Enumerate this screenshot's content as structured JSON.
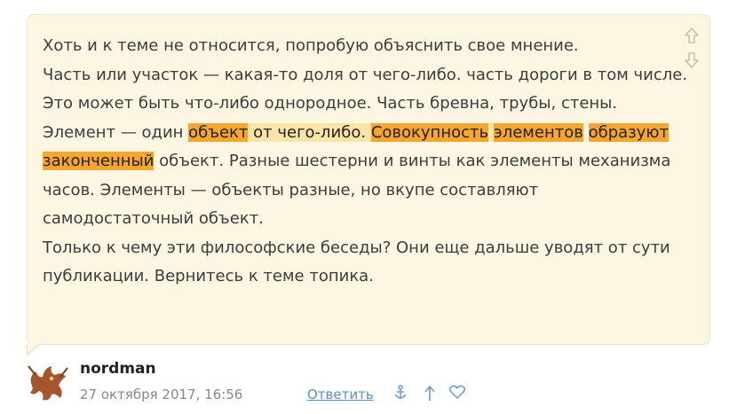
{
  "comment": {
    "lines": [
      [
        "Хоть и к теме не относится, попробую объяснить свое мнение."
      ],
      [
        "Часть или участок — какая-то доля от чего-либо. часть дороги в том числе. Это может быть что-либо однородное. Часть бревна, трубы, стены."
      ],
      [
        "Элемент — один ",
        "объект",
        " ",
        "от чего-либо.",
        " ",
        "Совокупность",
        " ",
        "элементов",
        " ",
        "образуют",
        " ",
        "законченный",
        " объект. Разные шестерни и винты как элементы механизма часов. Элементы — объекты разные, но вкупе составляют самодостаточный объект."
      ],
      [
        "Только к чему эти философские беседы? Они еще дальше уводят от сути публикации. Вернитесь к теме топика."
      ]
    ]
  },
  "votes": {
    "up_icon": "arrow-up-outline-icon",
    "down_icon": "arrow-down-outline-icon"
  },
  "author": {
    "name": "nordman",
    "avatar_icon": "dragon-avatar"
  },
  "meta": {
    "date": "27 октября 2017, 16:56",
    "reply_label": "Ответить",
    "anchor_icon": "anchor-icon",
    "parent_icon": "arrow-up-icon",
    "favorite_icon": "heart-icon"
  },
  "colors": {
    "highlight_strong": "#f6a62f",
    "highlight_weak": "#fbe4a5",
    "bubble_bg": "#fdf6e3",
    "link": "#5b8ec4"
  }
}
